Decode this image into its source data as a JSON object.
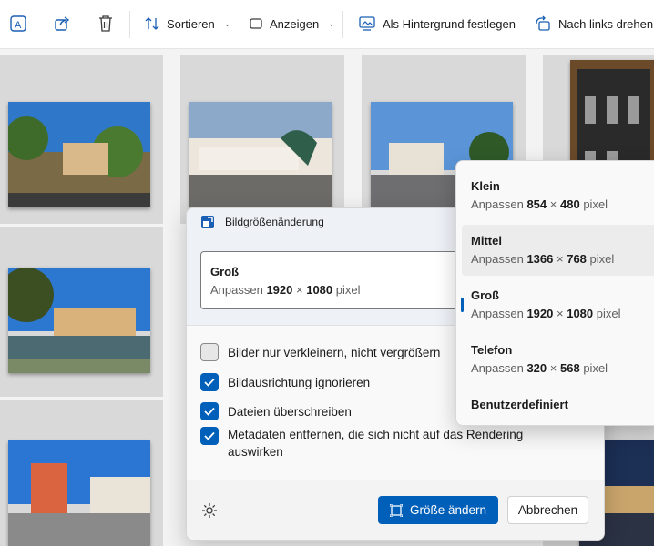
{
  "toolbar": {
    "sort_label": "Sortieren",
    "view_label": "Anzeigen",
    "wallpaper_label": "Als Hintergrund festlegen",
    "rotate_label": "Nach links drehen",
    "icons": [
      "ai-text-icon",
      "share-icon",
      "trash-icon",
      "sort-icon",
      "view-icon",
      "wallpaper-icon",
      "rotate-left-icon"
    ]
  },
  "dialog": {
    "title": "Bildgrößenänderung",
    "selected": {
      "name": "Groß",
      "prefix": "Anpassen",
      "width": "1920",
      "times": "×",
      "height": "1080",
      "unit": "pixel"
    },
    "options": [
      {
        "label": "Bilder nur verkleinern, nicht vergrößern",
        "checked": false
      },
      {
        "label": "Bildausrichtung ignorieren",
        "checked": true
      },
      {
        "label": "Dateien überschreiben",
        "checked": true
      },
      {
        "label": "Metadaten entfernen, die sich nicht auf das Rendering auswirken",
        "checked": true
      }
    ],
    "resize_button": "Größe ändern",
    "cancel_button": "Abbrechen"
  },
  "dropdown": {
    "items": [
      {
        "name": "Klein",
        "prefix": "Anpassen",
        "width": "854",
        "times": "×",
        "height": "480",
        "unit": "pixel"
      },
      {
        "name": "Mittel",
        "prefix": "Anpassen",
        "width": "1366",
        "times": "×",
        "height": "768",
        "unit": "pixel"
      },
      {
        "name": "Groß",
        "prefix": "Anpassen",
        "width": "1920",
        "times": "×",
        "height": "1080",
        "unit": "pixel"
      },
      {
        "name": "Telefon",
        "prefix": "Anpassen",
        "width": "320",
        "times": "×",
        "height": "568",
        "unit": "pixel"
      },
      {
        "name": "Benutzerdefiniert"
      }
    ],
    "hovered_index": 1,
    "selected_index": 2
  },
  "colors": {
    "accent": "#005fb8",
    "dialog_background": "#f9f9f9"
  }
}
